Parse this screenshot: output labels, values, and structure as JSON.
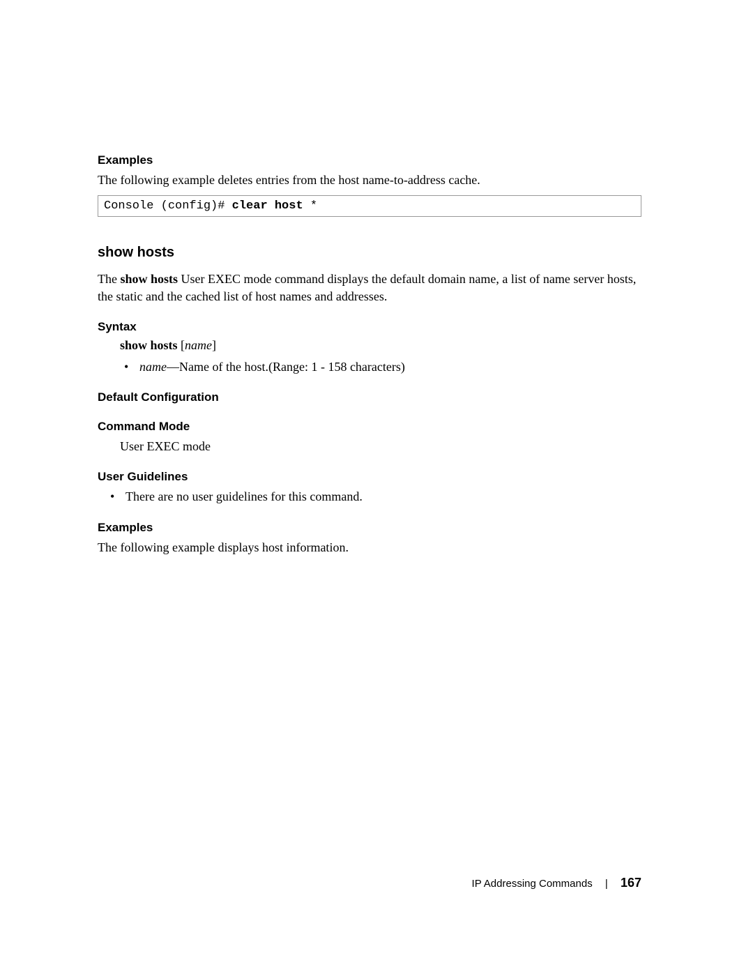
{
  "sections": {
    "examples1": {
      "heading": "Examples",
      "intro": "The following example deletes entries from the host name-to-address cache.",
      "code_prefix": "Console (config)# ",
      "code_bold": "clear host",
      "code_suffix": " *"
    },
    "show_hosts": {
      "heading": "show hosts",
      "desc_pre": "The ",
      "desc_bold": "show hosts",
      "desc_post": " User EXEC mode command displays the default domain name, a list of name server hosts, the static and the cached list of host names and addresses."
    },
    "syntax": {
      "heading": "Syntax",
      "cmd": "show hosts",
      "arg": "name",
      "bullet_arg": "name",
      "bullet_rest": "—Name of the host.(Range: 1 - 158 characters)"
    },
    "default_cfg": {
      "heading": "Default Configuration"
    },
    "cmd_mode": {
      "heading": "Command Mode",
      "text": "User EXEC mode"
    },
    "guidelines": {
      "heading": "User Guidelines",
      "bullet": "There are no user guidelines for this command."
    },
    "examples2": {
      "heading": "Examples",
      "intro": "The following example displays host information."
    }
  },
  "footer": {
    "section": "IP Addressing Commands",
    "page": "167"
  }
}
